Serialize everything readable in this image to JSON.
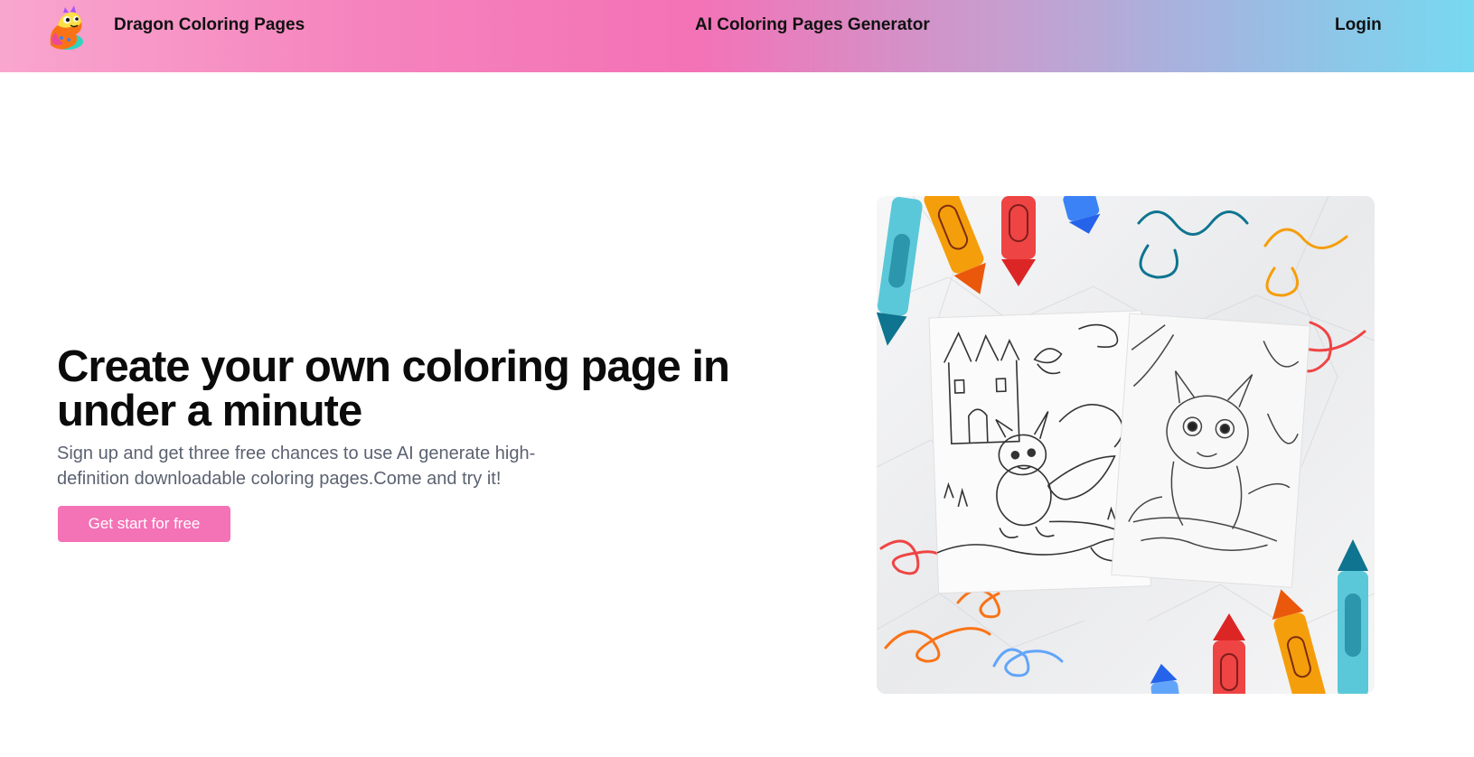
{
  "header": {
    "brand": "Dragon Coloring Pages",
    "nav_center": "AI Coloring Pages Generator",
    "login": "Login"
  },
  "hero": {
    "title": "Create your own coloring page in under a minute",
    "subtitle": "Sign up and get three free chances to use AI generate high-definition downloadable coloring pages.Come and try it!",
    "cta_label": "Get start for free"
  },
  "colors": {
    "accent": "#f472b6",
    "header_gradient_start": "#f9a6cf",
    "header_gradient_end": "#76d9f0"
  },
  "icons": {
    "logo": "baby-dragon-logo-icon"
  }
}
